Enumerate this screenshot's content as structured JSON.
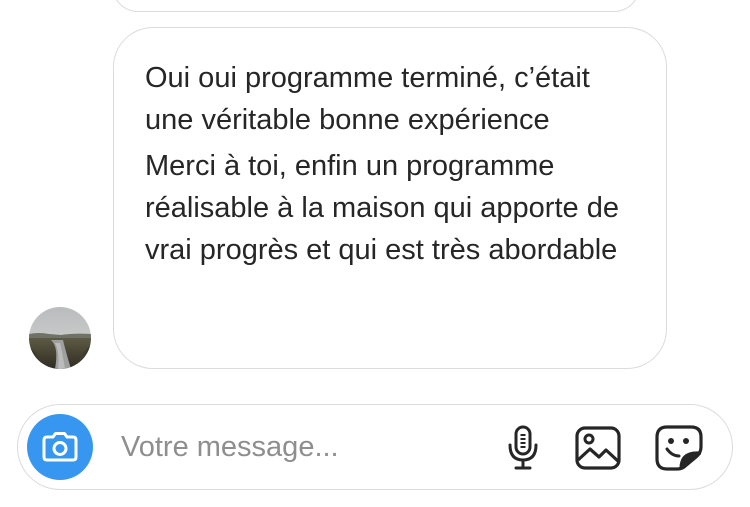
{
  "conversation": {
    "message": {
      "lines": [
        "Oui oui programme terminé, c’était une véritable bonne expérience",
        "Merci à toi, enfin un programme réalisable à la maison qui apporte de vrai progrès et qui est très abordable"
      ]
    },
    "sender_avatar": "landscape-photo-avatar"
  },
  "composer": {
    "placeholder": "Votre message...",
    "icons": {
      "camera": "camera-icon",
      "microphone": "microphone-icon",
      "gallery": "image-gallery-icon",
      "sticker": "sticker-icon"
    },
    "accent_color": "#3797f0"
  }
}
